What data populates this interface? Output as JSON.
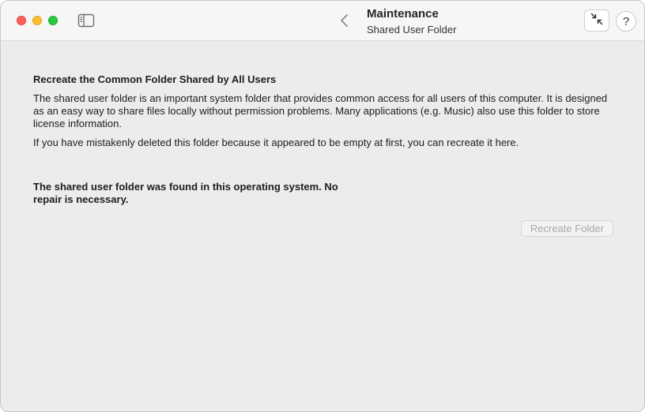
{
  "window": {
    "traffic_lights": {
      "close": "#ff5f57",
      "minimize": "#febc2e",
      "maximize": "#28c840"
    }
  },
  "toolbar": {
    "sidebar_toggle_icon": "sidebar-icon",
    "back_icon": "chevron-left-icon",
    "title": "Maintenance",
    "subtitle": "Shared User Folder",
    "collapse_icon": "arrows-collapse-icon",
    "help_label": "?"
  },
  "main": {
    "heading": "Recreate the Common Folder Shared by All Users",
    "description": "The shared user folder is an important system folder that provides common access for all users of this computer. It is designed as an easy way to share files locally without permission problems. Many applications (e.g. Music) also use this folder to store license information.",
    "note": "If you have mistakenly deleted this folder because it appeared to be empty at first, you can recreate it here.",
    "status": "The shared user folder was found in this operating system. No repair is necessary.",
    "recreate_button": {
      "label": "Recreate Folder",
      "enabled": false
    }
  }
}
